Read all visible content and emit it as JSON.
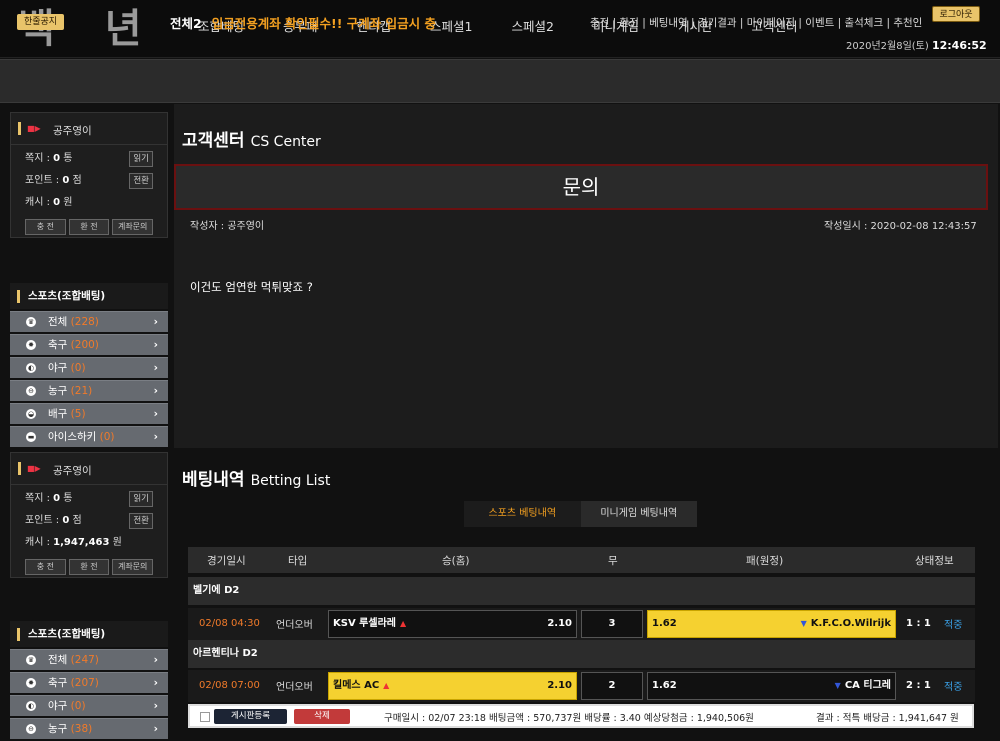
{
  "header": {
    "logo": "백년",
    "nav": [
      "조합베팅",
      "승무패",
      "핸디캡",
      "스페셜1",
      "스페셜2",
      "미니게임",
      "게시판",
      "고객센터"
    ],
    "logout": "로그아웃",
    "date": "2020년2월8일(토)",
    "time": "12:46:52"
  },
  "notice": {
    "badge": "한줄공지",
    "lead": "전체2",
    "text": "입금전용계좌 확인필수!! 구계좌 입금시 충",
    "links": "충전 | 환전 | 베팅내역 | 경기결과 | 마이페이지 | 이벤트 | 출석체크 | 추천인"
  },
  "sidebar": {
    "user": "공주영이",
    "msg_label": "쪽지 :",
    "msg_value": "0",
    "msg_unit": "통",
    "read": "읽기",
    "point_label": "포인트 :",
    "point_value": "0",
    "point_unit": "점",
    "convert": "전환",
    "cash_label": "캐시 :",
    "cash_value_1": "0",
    "cash_value_2": "1,947,463",
    "cash_unit": "원",
    "buttons": [
      "충 전",
      "환 전",
      "계좌문의"
    ],
    "sports_title": "스포츠(조합배팅)",
    "sports_1": [
      {
        "name": "전체",
        "count": "(228)"
      },
      {
        "name": "축구",
        "count": "(200)"
      },
      {
        "name": "야구",
        "count": "(0)"
      },
      {
        "name": "농구",
        "count": "(21)"
      },
      {
        "name": "배구",
        "count": "(5)"
      },
      {
        "name": "아이스하키",
        "count": "(0)"
      }
    ],
    "sports_2": [
      {
        "name": "전체",
        "count": "(247)"
      },
      {
        "name": "축구",
        "count": "(207)"
      },
      {
        "name": "야구",
        "count": "(0)"
      },
      {
        "name": "농구",
        "count": "(38)"
      }
    ]
  },
  "cs": {
    "title": "고객센터",
    "title_en": "CS Center",
    "inquiry": "문의",
    "author": "작성자 : 공주영이",
    "date": "작성일시 : 2020-02-08 12:43:57",
    "body": "이건도 엄연한 먹튀맞죠 ?"
  },
  "betting": {
    "title": "베팅내역",
    "title_en": "Betting List",
    "tab_sports": "스포츠 베팅내역",
    "tab_mini": "미니게임 베팅내역",
    "headers": [
      "경기일시",
      "타입",
      "승(홈)",
      "무",
      "패(원정)",
      "상태정보"
    ],
    "rows": [
      {
        "league": "벨기에 D2",
        "datetime": "02/08 04:30",
        "type": "언더오버",
        "home": "KSV 루셀라레",
        "home_odds": "2.10",
        "draw": "3",
        "away_odds": "1.62",
        "away": "K.F.C.O.Wilrijk",
        "score": "1 : 1",
        "status": "적중"
      },
      {
        "league": "아르헨티나 D2",
        "datetime": "02/08 07:00",
        "type": "언더오버",
        "home": "킬메스 AC",
        "home_odds": "2.10",
        "draw": "2",
        "away_odds": "1.62",
        "away": "CA 티그레",
        "score": "2 : 1",
        "status": "적중"
      }
    ],
    "summary": {
      "register": "게시판등록",
      "delete": "삭제",
      "text": "구매일시 : 02/07 23:18   배팅금액 : 570,737원   배당률 : 3.40   예상당첨금 : 1,940,506원",
      "result": "결과 : 적특 배당금 : 1,941,647 원"
    }
  },
  "colors": {
    "accent": "#e9c46a",
    "orange": "#f07a2a",
    "selected": "#f5d130",
    "status": "#3aa0e6"
  }
}
